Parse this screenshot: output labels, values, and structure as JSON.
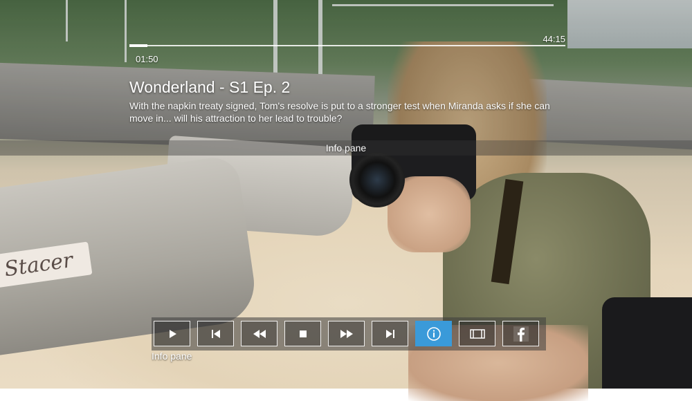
{
  "player": {
    "elapsed": "01:50",
    "duration": "44:15",
    "progress_fraction": 0.041
  },
  "episode": {
    "title": "Wonderland - S1 Ep. 2",
    "description": "With the napkin treaty signed, Tom's resolve is put to a stronger test when Miranda asks if she can move in... will his attraction to her lead to trouble?"
  },
  "info_pane": {
    "label": "Info pane"
  },
  "controls": {
    "buttons": [
      {
        "name": "play",
        "icon": "play-icon"
      },
      {
        "name": "previous",
        "icon": "skip-previous-icon"
      },
      {
        "name": "rewind",
        "icon": "rewind-icon"
      },
      {
        "name": "stop",
        "icon": "stop-icon"
      },
      {
        "name": "fast-forward",
        "icon": "fast-forward-icon"
      },
      {
        "name": "next",
        "icon": "skip-next-icon"
      },
      {
        "name": "info",
        "icon": "info-icon",
        "active": true
      },
      {
        "name": "film",
        "icon": "film-icon"
      },
      {
        "name": "facebook",
        "icon": "facebook-icon"
      }
    ],
    "tooltip": "Info pane"
  },
  "scene_text": {
    "boat_brand": "Stacer"
  },
  "colors": {
    "accent": "#3a9ad9"
  }
}
